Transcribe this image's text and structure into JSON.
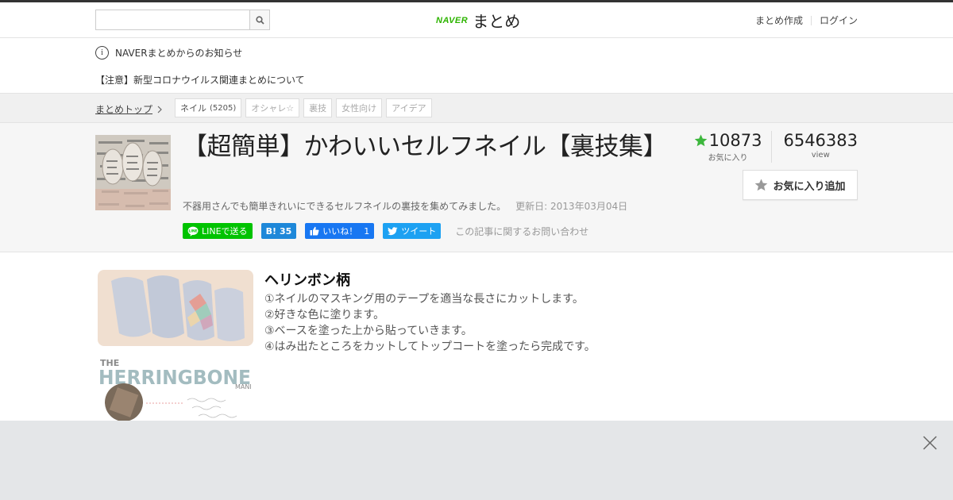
{
  "header": {
    "search": {
      "placeholder": "",
      "value": ""
    },
    "logo_brand": "NAVER",
    "logo_name": "まとめ",
    "links": [
      "まとめ作成",
      "ログイン"
    ]
  },
  "notice": {
    "heading": "NAVERまとめからのお知らせ",
    "link": "【注意】新型コロナウイルス関連まとめについて"
  },
  "breadcrumb": {
    "top_label": "まとめトップ",
    "tags": [
      {
        "label": "ネイル",
        "count": "(5205)"
      },
      {
        "label": "オシャレ☆"
      },
      {
        "label": "裏技"
      },
      {
        "label": "女性向け"
      },
      {
        "label": "アイデア"
      }
    ]
  },
  "article": {
    "title": "【超簡単】かわいいセルフネイル【裏技集】",
    "description": "不器用さんでも簡単きれいにできるセルフネイルの裏技を集めてみました。",
    "updated": "更新日: 2013年03月04日",
    "share": {
      "line": "LINEで送る",
      "hatena_count": "35",
      "like": "いいね！",
      "like_count": "1",
      "tweet": "ツイート"
    },
    "contact": "この記事に関するお問い合わせ",
    "stats": {
      "favorites": "10873",
      "favorites_label": "お気に入り",
      "views": "6546383",
      "views_label": "view"
    },
    "favorite_button": "お気に入り追加"
  },
  "item": {
    "image_caption": {
      "line1": "THE",
      "line2": "HERRINGBONE",
      "line3": "MANI"
    },
    "title": "ヘリンボン柄",
    "steps": [
      "①ネイルのマスキング用のテープを適当な長さにカットします。",
      "②好きな色に塗ります。",
      "③ベースを塗った上から貼っていきます。",
      "④はみ出たところをカットしてトップコートを塗ったら完成です。"
    ]
  },
  "colors": {
    "naver_green": "#2db400",
    "star_green": "#3db73d",
    "line_green": "#00c300",
    "facebook_blue": "#1877f2",
    "twitter_blue": "#1da1f2"
  }
}
